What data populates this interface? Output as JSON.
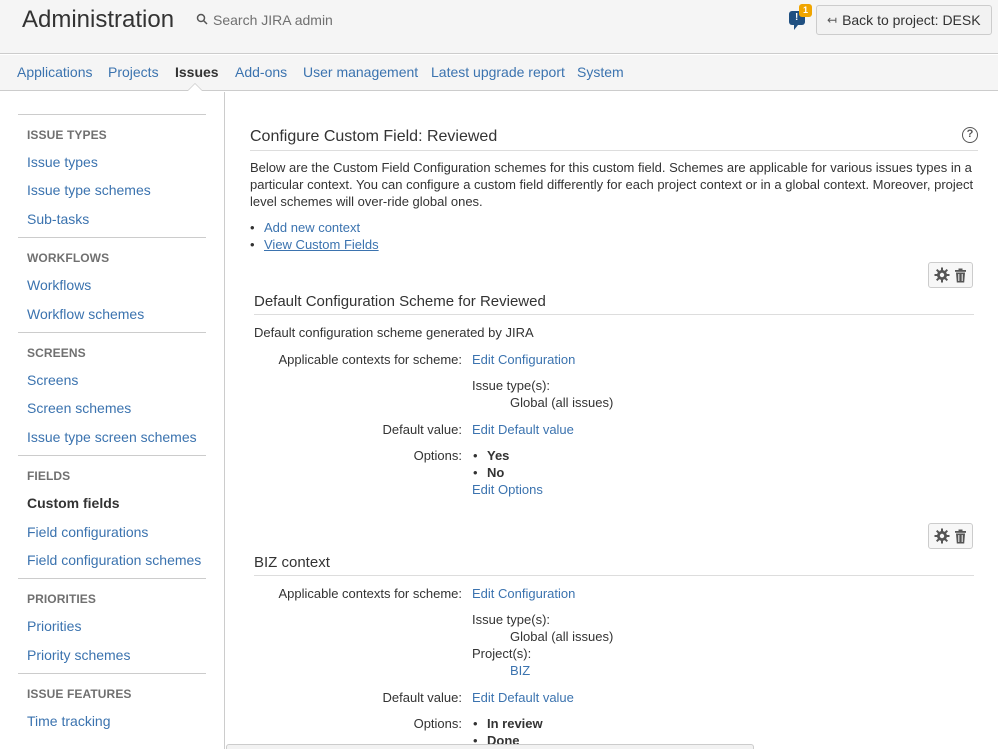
{
  "header": {
    "title": "Administration",
    "search_placeholder": "Search JIRA admin",
    "notification_count": "1",
    "back_button": "Back to project: DESK"
  },
  "nav": {
    "items": [
      "Applications",
      "Projects",
      "Issues",
      "Add-ons",
      "User management",
      "Latest upgrade report",
      "System"
    ],
    "active": "Issues"
  },
  "sidebar": {
    "sections": [
      {
        "heading": "ISSUE TYPES",
        "items": [
          "Issue types",
          "Issue type schemes",
          "Sub-tasks"
        ]
      },
      {
        "heading": "WORKFLOWS",
        "items": [
          "Workflows",
          "Workflow schemes"
        ]
      },
      {
        "heading": "SCREENS",
        "items": [
          "Screens",
          "Screen schemes",
          "Issue type screen schemes"
        ]
      },
      {
        "heading": "FIELDS",
        "items": [
          "Custom fields",
          "Field configurations",
          "Field configuration schemes"
        ]
      },
      {
        "heading": "PRIORITIES",
        "items": [
          "Priorities",
          "Priority schemes"
        ]
      },
      {
        "heading": "ISSUE FEATURES",
        "items": [
          "Time tracking"
        ]
      }
    ],
    "active_item": "Custom fields"
  },
  "main": {
    "title": "Configure Custom Field: Reviewed",
    "description": "Below are the Custom Field Configuration schemes for this custom field. Schemes are applicable for various issues types in a particular context. You can configure a custom field differently for each project context or in a global context. Moreover, project level schemes will over-ride global ones.",
    "links": [
      "Add new context",
      "View Custom Fields"
    ],
    "schemes": [
      {
        "title": "Default Configuration Scheme for Reviewed",
        "description": "Default configuration scheme generated by JIRA",
        "applicable_label": "Applicable contexts for scheme:",
        "edit_config": "Edit Configuration",
        "issue_types_label": "Issue type(s):",
        "issue_types_value": "Global (all issues)",
        "default_label": "Default value:",
        "edit_default": "Edit Default value",
        "options_label": "Options:",
        "options": [
          "Yes",
          "No"
        ],
        "edit_options": "Edit Options"
      },
      {
        "title": "BIZ context",
        "applicable_label": "Applicable contexts for scheme:",
        "edit_config": "Edit Configuration",
        "issue_types_label": "Issue type(s):",
        "issue_types_value": "Global (all issues)",
        "projects_label": "Project(s):",
        "projects_value": "BIZ",
        "default_label": "Default value:",
        "edit_default": "Edit Default value",
        "options_label": "Options:",
        "options": [
          "In review",
          "Done"
        ]
      }
    ]
  },
  "colors": {
    "link": "#3b73af",
    "header_bg": "#f5f5f5",
    "notification_accent": "#f0a500",
    "notification_icon": "#205081"
  },
  "icons": {
    "search": "search-icon",
    "notification": "notification-icon",
    "back": "back-arrow-icon",
    "help": "help-icon",
    "gear": "gear-icon",
    "trash": "trash-icon"
  }
}
